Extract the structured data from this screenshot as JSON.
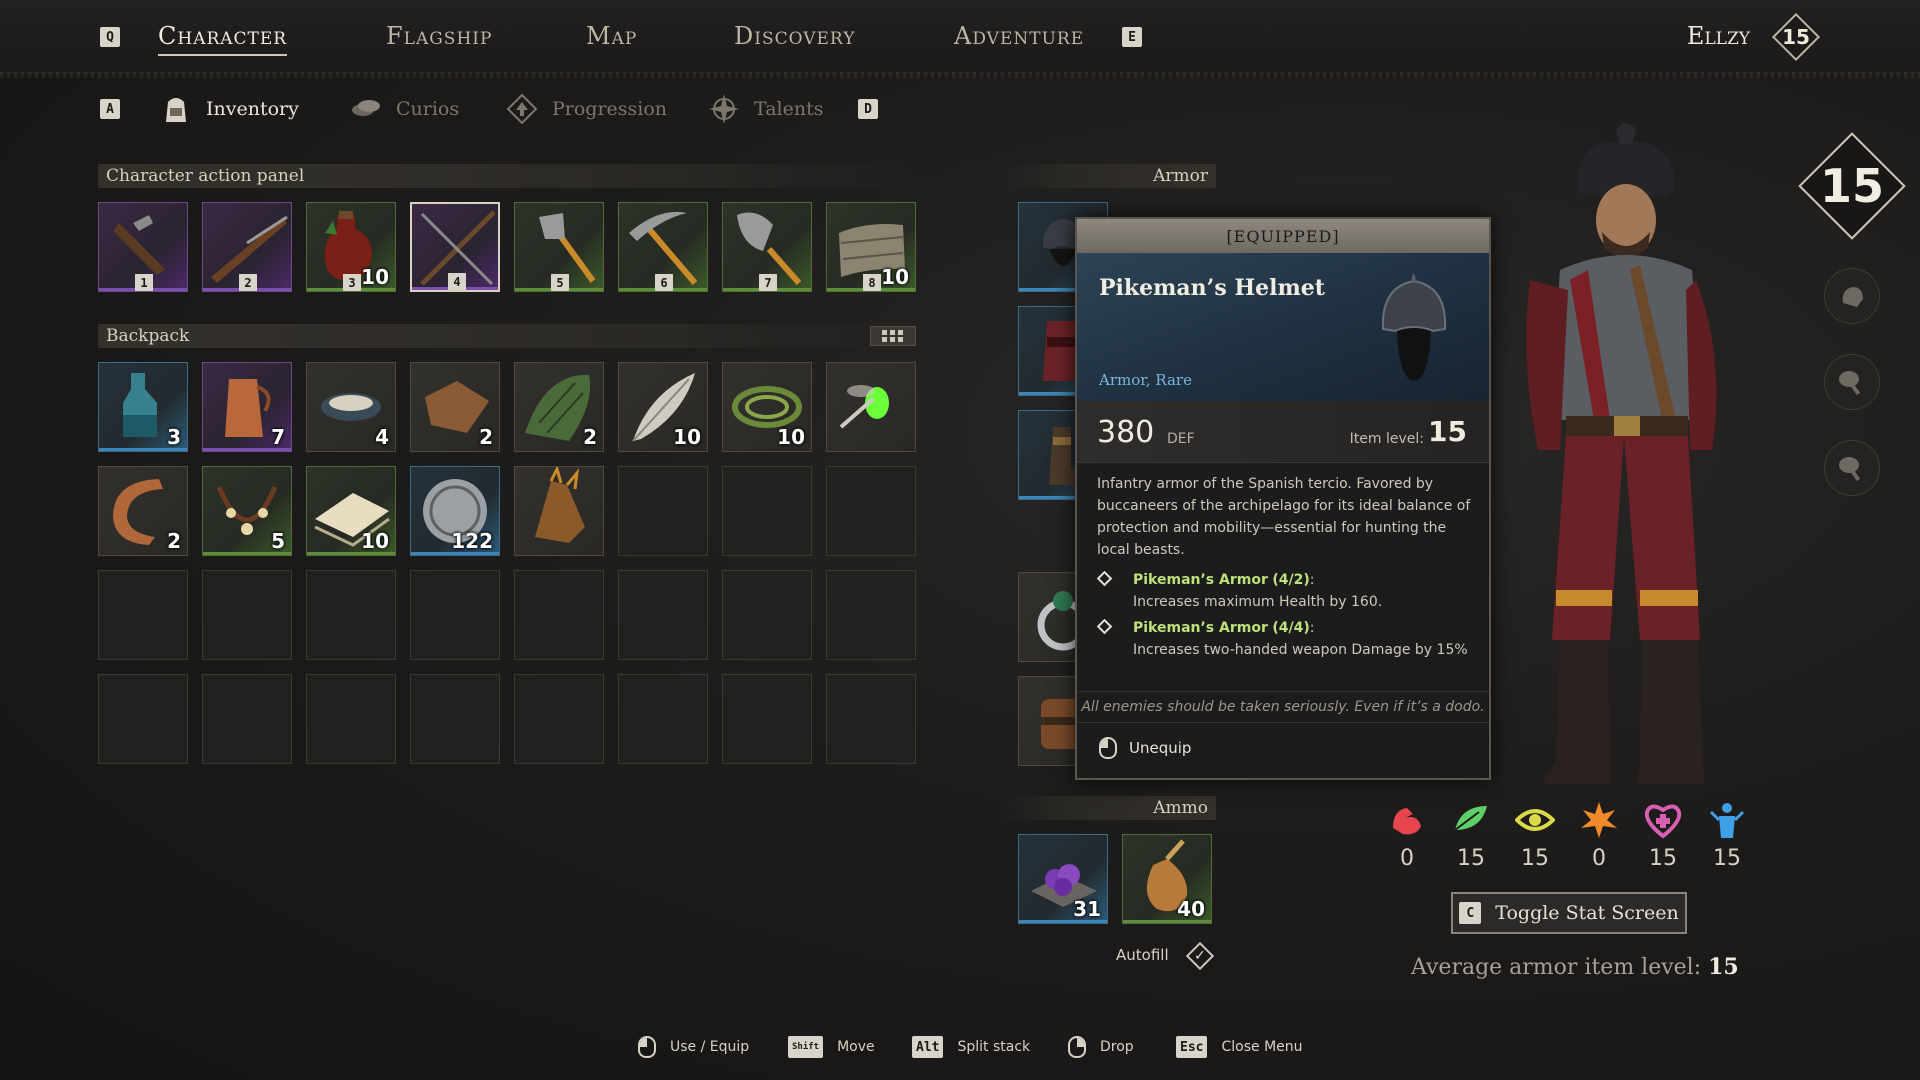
{
  "nav": {
    "prev_key": "Q",
    "next_key": "E",
    "tabs": [
      "Character",
      "Flagship",
      "Map",
      "Discovery",
      "Adventure"
    ],
    "active": "Character"
  },
  "player": {
    "name": "Ellzy",
    "level": "15"
  },
  "subnav": {
    "prev_key": "A",
    "next_key": "D",
    "tabs": [
      "Inventory",
      "Curios",
      "Progression",
      "Talents"
    ],
    "active": "Inventory"
  },
  "action_panel": {
    "title": "Character action panel",
    "slots": [
      {
        "icon": "flintlock-pistol-icon",
        "rarity": "purple",
        "hotkey": "1",
        "count": ""
      },
      {
        "icon": "musket-icon",
        "rarity": "purple",
        "hotkey": "2",
        "count": ""
      },
      {
        "icon": "health-potion-icon",
        "rarity": "green",
        "hotkey": "3",
        "count": "10"
      },
      {
        "icon": "pike-spear-icon",
        "rarity": "purple",
        "hotkey": "4",
        "count": ""
      },
      {
        "icon": "axe-icon",
        "rarity": "green",
        "hotkey": "5",
        "count": ""
      },
      {
        "icon": "pickaxe-icon",
        "rarity": "green",
        "hotkey": "6",
        "count": ""
      },
      {
        "icon": "shovel-icon",
        "rarity": "green",
        "hotkey": "7",
        "count": ""
      },
      {
        "icon": "bandage-icon",
        "rarity": "green",
        "hotkey": "8",
        "count": "10"
      }
    ]
  },
  "backpack": {
    "title": "Backpack",
    "slots": [
      {
        "icon": "flask-icon",
        "rarity": "blue",
        "count": "3"
      },
      {
        "icon": "copper-pot-icon",
        "rarity": "purple",
        "count": "7"
      },
      {
        "icon": "bowl-icon",
        "rarity": "grey",
        "count": "4"
      },
      {
        "icon": "leather-hide-icon",
        "rarity": "grey",
        "count": "2"
      },
      {
        "icon": "reptile-scale-icon",
        "rarity": "grey",
        "count": "2"
      },
      {
        "icon": "feather-icon",
        "rarity": "grey",
        "count": "10"
      },
      {
        "icon": "fiber-rope-icon",
        "rarity": "grey",
        "count": "10"
      },
      {
        "icon": "firefly-icon",
        "rarity": "grey",
        "count": ""
      },
      {
        "icon": "curved-horn-icon",
        "rarity": "grey",
        "count": "2"
      },
      {
        "icon": "tooth-necklace-icon",
        "rarity": "green",
        "count": "5"
      },
      {
        "icon": "cloth-bundle-icon",
        "rarity": "green",
        "count": "10"
      },
      {
        "icon": "silver-coin-icon",
        "rarity": "blue",
        "count": "122"
      },
      {
        "icon": "beast-trophy-icon",
        "rarity": "grey",
        "count": ""
      },
      {
        "icon": "",
        "rarity": "empty",
        "count": ""
      },
      {
        "icon": "",
        "rarity": "empty",
        "count": ""
      },
      {
        "icon": "",
        "rarity": "empty",
        "count": ""
      },
      {
        "icon": "",
        "rarity": "empty",
        "count": ""
      },
      {
        "icon": "",
        "rarity": "empty",
        "count": ""
      },
      {
        "icon": "",
        "rarity": "empty",
        "count": ""
      },
      {
        "icon": "",
        "rarity": "empty",
        "count": ""
      },
      {
        "icon": "",
        "rarity": "empty",
        "count": ""
      },
      {
        "icon": "",
        "rarity": "empty",
        "count": ""
      },
      {
        "icon": "",
        "rarity": "empty",
        "count": ""
      },
      {
        "icon": "",
        "rarity": "empty",
        "count": ""
      },
      {
        "icon": "",
        "rarity": "empty",
        "count": ""
      },
      {
        "icon": "",
        "rarity": "empty",
        "count": ""
      },
      {
        "icon": "",
        "rarity": "empty",
        "count": ""
      },
      {
        "icon": "",
        "rarity": "empty",
        "count": ""
      },
      {
        "icon": "",
        "rarity": "empty",
        "count": ""
      },
      {
        "icon": "",
        "rarity": "empty",
        "count": ""
      },
      {
        "icon": "",
        "rarity": "empty",
        "count": ""
      },
      {
        "icon": "",
        "rarity": "empty",
        "count": ""
      }
    ]
  },
  "armor": {
    "title": "Armor"
  },
  "ammo": {
    "title": "Ammo",
    "slots": [
      {
        "icon": "purple-shot-icon",
        "rarity": "blue",
        "count": "31"
      },
      {
        "icon": "powder-horn-icon",
        "rarity": "green",
        "count": "40"
      }
    ],
    "autofill_label": "Autofill"
  },
  "tooltip": {
    "status": "[EQUIPPED]",
    "name": "Pikeman’s Helmet",
    "type": "Armor, Rare",
    "def_value": "380",
    "def_label": "DEF",
    "item_level_label": "Item level:",
    "item_level": "15",
    "description": "Infantry armor of the Spanish tercio. Favored by buccaneers of the archipelago for its ideal balance of protection and mobility—essential for hunting the local beasts.",
    "bonuses": [
      {
        "name": "Pikeman’s Armor",
        "tier": "(4/2)",
        "text": "Increases maximum Health by 160."
      },
      {
        "name": "Pikeman’s Armor",
        "tier": "(4/4)",
        "text": "Increases two-handed weapon Damage by 15%"
      }
    ],
    "flavor": "All enemies should be taken seriously. Even if it’s a dodo.",
    "unequip_label": "Unequip"
  },
  "character": {
    "level": "15",
    "attributes": [
      {
        "icon": "strength-arm-icon",
        "color": "#e8464f",
        "value": "0"
      },
      {
        "icon": "agility-leaf-icon",
        "color": "#5fd067",
        "value": "15"
      },
      {
        "icon": "perception-eye-icon",
        "color": "#d9d94a",
        "value": "15"
      },
      {
        "icon": "power-burst-icon",
        "color": "#f08a2a",
        "value": "0"
      },
      {
        "icon": "vitality-heart-icon",
        "color": "#d65fb2",
        "value": "15"
      },
      {
        "icon": "spirit-figure-icon",
        "color": "#3fa0e6",
        "value": "15"
      }
    ],
    "toggle_key": "C",
    "toggle_label": "Toggle Stat Screen",
    "avg_label": "Average armor item level:",
    "avg_value": "15"
  },
  "footer": [
    {
      "key": "mouse-left",
      "label": "Use / Equip"
    },
    {
      "key": "Shift",
      "label": "Move"
    },
    {
      "key": "Alt",
      "label": "Split stack"
    },
    {
      "key": "mouse-right",
      "label": "Drop"
    },
    {
      "key": "Esc",
      "label": "Close Menu"
    }
  ]
}
